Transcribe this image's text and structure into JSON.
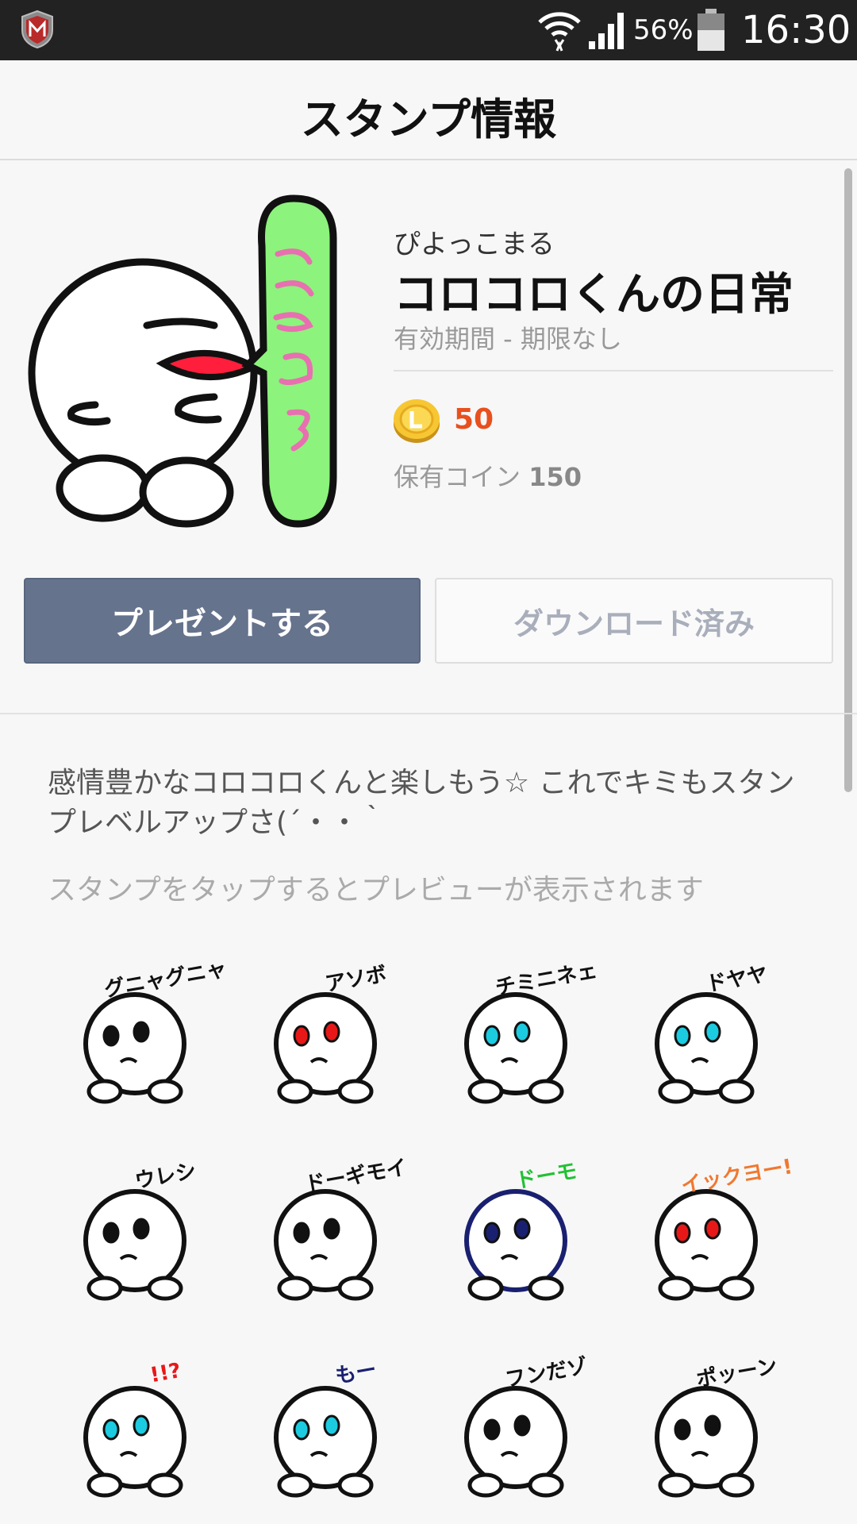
{
  "status_bar": {
    "battery_pct": "56%",
    "time": "16:30"
  },
  "header": {
    "title": "スタンプ情報"
  },
  "pack": {
    "creator": "ぴよっこまる",
    "name": "コロコロくんの日常",
    "validity": "有効期間 - 期限なし",
    "price": "50",
    "owned_label": "保有コイン",
    "owned_value": "150"
  },
  "buttons": {
    "present": "プレゼントする",
    "downloaded": "ダウンロード済み"
  },
  "description": "感情豊かなコロコロくんと楽しもう☆ これでキミもスタンプレベルアップさ(´・・｀",
  "hint": "スタンプをタップするとプレビューが表示されます",
  "stickers": [
    {
      "caption": "グニャグニャ",
      "eye": "#111111",
      "text_color": "#111111"
    },
    {
      "caption": "アソボ",
      "eye": "#e81818",
      "text_color": "#111111"
    },
    {
      "caption": "チミニネェ",
      "eye": "#1ccbe0",
      "text_color": "#111111"
    },
    {
      "caption": "ドヤヤ",
      "eye": "#1ccbe0",
      "text_color": "#111111"
    },
    {
      "caption": "ウレシ",
      "eye": "#111111",
      "text_color": "#111111"
    },
    {
      "caption": "ドーギモイ",
      "eye": "#111111",
      "text_color": "#111111"
    },
    {
      "caption": "ドーモ",
      "eye": "#1a2070",
      "text_color": "#22c033"
    },
    {
      "caption": "イックヨー!",
      "eye": "#e81818",
      "text_color": "#f07830"
    },
    {
      "caption": "!!?",
      "eye": "#1ccbe0",
      "text_color": "#e81818"
    },
    {
      "caption": "もー",
      "eye": "#1ccbe0",
      "text_color": "#1a2070"
    },
    {
      "caption": "フンだゾ",
      "eye": "#111111",
      "text_color": "#111111"
    },
    {
      "caption": "ポッーン",
      "eye": "#111111",
      "text_color": "#111111"
    }
  ]
}
